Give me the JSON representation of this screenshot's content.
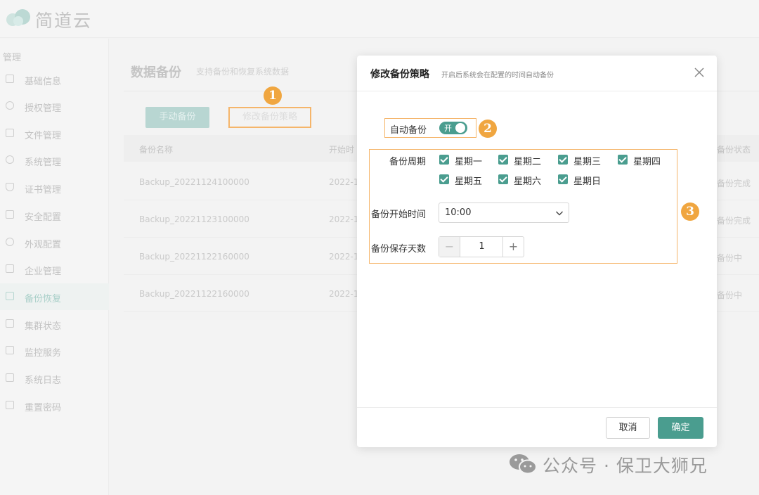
{
  "app": {
    "brand": "简道云"
  },
  "sidebar": {
    "section_title": "管理",
    "items": [
      {
        "label": "基础信息"
      },
      {
        "label": "授权管理"
      },
      {
        "label": "文件管理"
      },
      {
        "label": "系统管理"
      },
      {
        "label": "证书管理"
      },
      {
        "label": "安全配置"
      },
      {
        "label": "外观配置"
      },
      {
        "label": "企业管理"
      },
      {
        "label": "备份恢复",
        "active": true
      },
      {
        "label": "集群状态"
      },
      {
        "label": "监控服务"
      },
      {
        "label": "系统日志"
      },
      {
        "label": "重置密码"
      }
    ]
  },
  "page": {
    "title": "数据备份",
    "subtitle": "支持备份和恢复系统数据",
    "manual_backup_label": "手动备份",
    "edit_policy_label": "修改备份策略"
  },
  "table": {
    "columns": [
      "备份名称",
      "开始时",
      "备份状态"
    ],
    "rows": [
      {
        "name": "Backup_20221124100000",
        "start": "2022-1",
        "status": "备份完成"
      },
      {
        "name": "Backup_20221123100000",
        "start": "2022-1",
        "status": "备份完成"
      },
      {
        "name": "Backup_20221122160000",
        "start": "2022-1",
        "status": "备份中"
      },
      {
        "name": "Backup_20221122160000",
        "start": "2022-1",
        "status": "备份中"
      }
    ]
  },
  "badges": [
    "1",
    "2",
    "3"
  ],
  "dialog": {
    "title": "修改备份策略",
    "subtitle": "开启后系统会在配置的时间自动备份",
    "auto_backup_label": "自动备份",
    "toggle_text": "开",
    "toggle_on": true,
    "cycle_label": "备份周期",
    "days": [
      {
        "label": "星期一",
        "checked": true
      },
      {
        "label": "星期二",
        "checked": true
      },
      {
        "label": "星期三",
        "checked": true
      },
      {
        "label": "星期四",
        "checked": true
      },
      {
        "label": "星期五",
        "checked": true
      },
      {
        "label": "星期六",
        "checked": true
      },
      {
        "label": "星期日",
        "checked": true
      }
    ],
    "start_time_label": "备份开始时间",
    "start_time_value": "10:00",
    "retention_label": "备份保存天数",
    "retention_value": "1",
    "stepper_minus": "−",
    "stepper_plus": "+",
    "cancel_label": "取消",
    "ok_label": "确定"
  },
  "watermark": {
    "text": "公众号 · 保卫大狮兄"
  },
  "colors": {
    "accent": "#4a9d8f",
    "highlight": "#f5b56a",
    "badge": "#f0a640"
  }
}
